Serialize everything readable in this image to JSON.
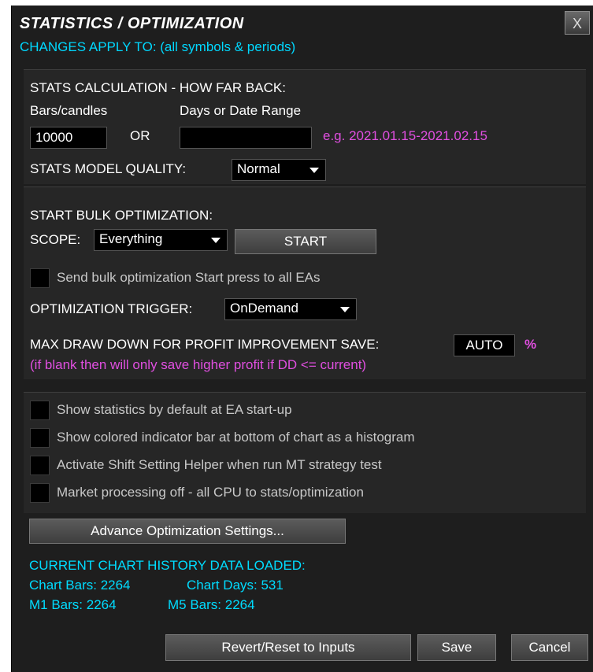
{
  "header": {
    "title": "STATISTICS / OPTIMIZATION",
    "subtitle": "CHANGES APPLY TO: (all symbols & periods)",
    "close_label": "X"
  },
  "stats": {
    "heading": "STATS CALCULATION - HOW FAR BACK:",
    "bars_label": "Bars/candles",
    "days_label": "Days or Date Range",
    "bars_value": "10000",
    "or_label": "OR",
    "days_value": "",
    "example": "e.g. 2021.01.15-2021.02.15",
    "quality_label": "STATS MODEL QUALITY:",
    "quality_value": "Normal"
  },
  "bulk": {
    "heading": "START BULK OPTIMIZATION:",
    "scope_label": "SCOPE:",
    "scope_value": "Everything",
    "start_label": "START",
    "send_all_label": "Send bulk optimization Start press to all EAs",
    "trigger_label": "OPTIMIZATION TRIGGER:",
    "trigger_value": "OnDemand",
    "maxdd_label": "MAX DRAW DOWN FOR PROFIT IMPROVEMENT SAVE:",
    "maxdd_value": "AUTO",
    "maxdd_unit": "%",
    "maxdd_note": "(if blank then will only save higher profit if DD <= current)"
  },
  "options": {
    "items": [
      "Show statistics by default at EA start-up",
      "Show colored indicator bar at bottom of chart as a histogram",
      "Activate Shift Setting Helper when run MT strategy test",
      "Market processing off - all CPU to stats/optimization"
    ]
  },
  "advance_button": "Advance Optimization Settings...",
  "history": {
    "heading": "CURRENT CHART HISTORY DATA LOADED:",
    "chart_bars": "Chart Bars: 2264",
    "chart_days": "Chart Days: 531",
    "m1_bars": "M1 Bars: 2264",
    "m5_bars": "M5 Bars: 2264"
  },
  "footer": {
    "revert_label": "Revert/Reset to Inputs",
    "save_label": "Save",
    "cancel_label": "Cancel"
  },
  "colors": {
    "accent_cyan": "#00dcff",
    "note_magenta": "#e04fe0",
    "background": "#1e1e1e"
  }
}
